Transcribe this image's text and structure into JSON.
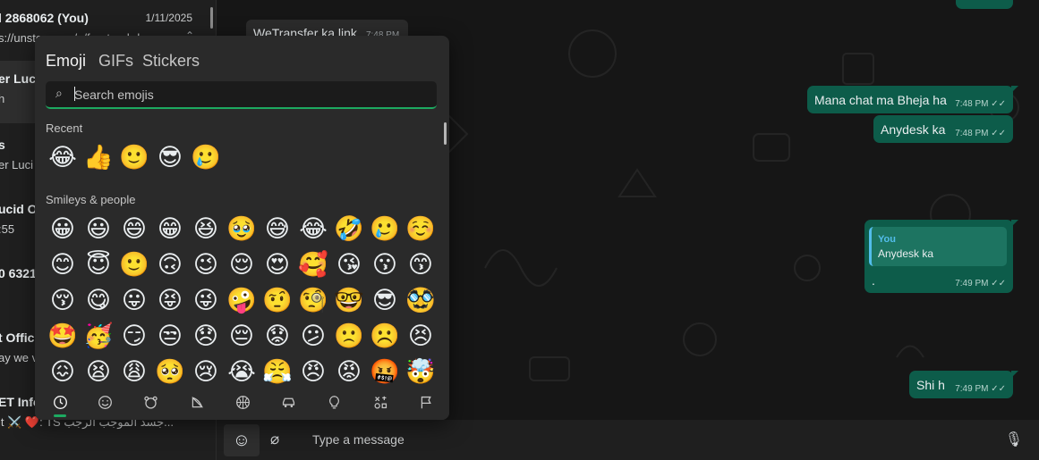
{
  "chat_list": [
    {
      "name": "l 2868062 (You)",
      "preview": "s://unstop.com/o/frontend-d...",
      "date": "1/11/2025",
      "selected": false
    },
    {
      "name": "er Luci",
      "preview": "h",
      "date": "",
      "selected": true
    },
    {
      "name": "s",
      "preview": "er Luci",
      "date": "",
      "selected": false
    },
    {
      "name": "ucid O",
      "preview": ":55",
      "date": "",
      "selected": false
    },
    {
      "name": "0 6321",
      "preview": "",
      "date": "",
      "selected": false
    },
    {
      "name": "t Offic",
      "preview": "ay we v",
      "date": "",
      "selected": false
    },
    {
      "name": "ET Info",
      "preview": "it ⚔️  ❤️: TS جسد الموجب الرجب...",
      "date": "",
      "selected": false
    }
  ],
  "messages": {
    "incoming": {
      "text": "WeTransfer ka link",
      "time": "7:48 PM"
    },
    "outgoing": [
      {
        "text": "Mana chat ma Bheja ha",
        "time": "7:48 PM"
      },
      {
        "text": "Anydesk ka",
        "time": "7:48 PM"
      },
      {
        "quote_author": "You",
        "quote_text": "Anydesk ka",
        "text": ".",
        "time": "7:49 PM"
      },
      {
        "text": "Shi h",
        "time": "7:49 PM"
      }
    ]
  },
  "input_bar": {
    "emoji_icon": "smiley-icon",
    "attach_icon": "paperclip-icon",
    "placeholder": "Type a message",
    "mic_icon": "microphone-icon"
  },
  "emoji_panel": {
    "tabs": [
      "Emoji",
      "GIFs",
      "Stickers"
    ],
    "active_tab": "Emoji",
    "search_placeholder": "Search emojis",
    "sections": {
      "recent": {
        "title": "Recent",
        "emojis": [
          "😂",
          "👍",
          "🙂",
          "😎",
          "🥲"
        ]
      },
      "smileys": {
        "title": "Smileys & people",
        "rows": [
          [
            "😀",
            "😃",
            "😄",
            "😁",
            "😆",
            "🥹",
            "😅",
            "😂",
            "🤣",
            "🥲",
            "☺️"
          ],
          [
            "😊",
            "😇",
            "🙂",
            "🙃",
            "😉",
            "😌",
            "😍",
            "🥰",
            "😘",
            "😗",
            "😙"
          ],
          [
            "😚",
            "😋",
            "😛",
            "😝",
            "😜",
            "🤪",
            "🤨",
            "🧐",
            "🤓",
            "😎",
            "🥸"
          ],
          [
            "🤩",
            "🥳",
            "😏",
            "😒",
            "😞",
            "😔",
            "😟",
            "😕",
            "🙁",
            "☹️",
            "😣"
          ],
          [
            "😖",
            "😫",
            "😩",
            "🥺",
            "😢",
            "😭",
            "😤",
            "😠",
            "😡",
            "🤬",
            "🤯"
          ]
        ]
      }
    },
    "categories": [
      "clock-icon",
      "smiley-face-icon",
      "animal-icon",
      "food-icon",
      "ball-icon",
      "car-icon",
      "lightbulb-icon",
      "symbols-icon",
      "flag-icon"
    ],
    "active_category": "clock-icon"
  },
  "colors": {
    "accent": "#1daa61",
    "outgoing_bubble": "#0d5c4a",
    "panel_bg": "#2a2a2a"
  }
}
